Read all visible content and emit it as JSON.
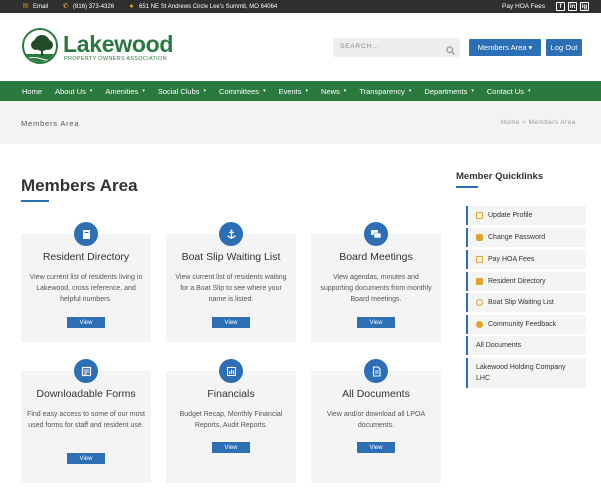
{
  "topbar": {
    "email": "Email",
    "phone": "(816) 373-4326",
    "address": "651 NE St Andrews Circle Lee's Summit, MO 64064",
    "pay_hoa": "Pay HOA Fees",
    "social": [
      "f",
      "in",
      "ig"
    ]
  },
  "header": {
    "logo_name": "Lakewood",
    "logo_sub": "PROPERTY OWNERS ASSOCIATION",
    "search_placeholder": "SEARCH...",
    "members_btn": "Members Area ▾",
    "logout_btn": "Log Out"
  },
  "nav": [
    {
      "label": "Home",
      "caret": ""
    },
    {
      "label": "About Us",
      "caret": "▾"
    },
    {
      "label": "Amenities",
      "caret": "▾"
    },
    {
      "label": "Social Clubs",
      "caret": "▾"
    },
    {
      "label": "Committees",
      "caret": "▾"
    },
    {
      "label": "Events",
      "caret": "▾"
    },
    {
      "label": "News",
      "caret": "▾"
    },
    {
      "label": "Transparency",
      "caret": "▾"
    },
    {
      "label": "Departments",
      "caret": "▾"
    },
    {
      "label": "Contact Us",
      "caret": "▾"
    }
  ],
  "breadcrumb": {
    "title": "Members Area",
    "trail": "Home  >  Members Area"
  },
  "main": {
    "title": "Members Area",
    "cards": [
      {
        "title": "Resident Directory",
        "desc": "View current list of residents living in Lakewood, cross reference, and helpful numbers.",
        "button": "View",
        "icon": "book-icon"
      },
      {
        "title": "Boat Slip Waiting List",
        "desc": "View current list of residents waiting for a Boat Slip to see where your name is listed.",
        "button": "View",
        "icon": "anchor-icon"
      },
      {
        "title": "Board Meetings",
        "desc": "View agendas, minutes and supporting documents from monthly Board meetings.",
        "button": "View",
        "icon": "chat-icon"
      },
      {
        "title": "Downloadable Forms",
        "desc": "Find easy access to some of our most used forms for staff and resident use.",
        "button": "View",
        "icon": "forms-icon"
      },
      {
        "title": "Financials",
        "desc": "Budget Recap, Monthly Financial Reports, Audit Reports.",
        "button": "View",
        "icon": "chart-icon"
      },
      {
        "title": "All Documents",
        "desc": "View and/or download all LPOA documents.",
        "button": "View",
        "icon": "document-icon"
      }
    ]
  },
  "sidebar": {
    "title": "Member Quicklinks",
    "links": [
      {
        "label": "Update Profile",
        "icon": "profile-icon",
        "color": "#e2a32b"
      },
      {
        "label": "Change Password",
        "icon": "lock-icon",
        "color": "#e2a32b"
      },
      {
        "label": "Pay HOA Fees",
        "icon": "dollar-icon",
        "color": "#e2a32b"
      },
      {
        "label": "Resident Directory",
        "icon": "book-icon",
        "color": "#e2a32b"
      },
      {
        "label": "Boat Slip Waiting List",
        "icon": "anchor-icon",
        "color": "#e2a32b"
      },
      {
        "label": "Community Feedback",
        "icon": "chat-icon",
        "color": "#e2a32b"
      },
      {
        "label": "All Documents",
        "icon": "",
        "color": ""
      },
      {
        "label": "Lakewood Holding Company LHC",
        "icon": "",
        "color": ""
      }
    ]
  },
  "colors": {
    "brand_green": "#2a7a3f",
    "accent_blue": "#2d6fb5",
    "accent_orange": "#e2a32b",
    "topbar": "#2f2f2f"
  }
}
